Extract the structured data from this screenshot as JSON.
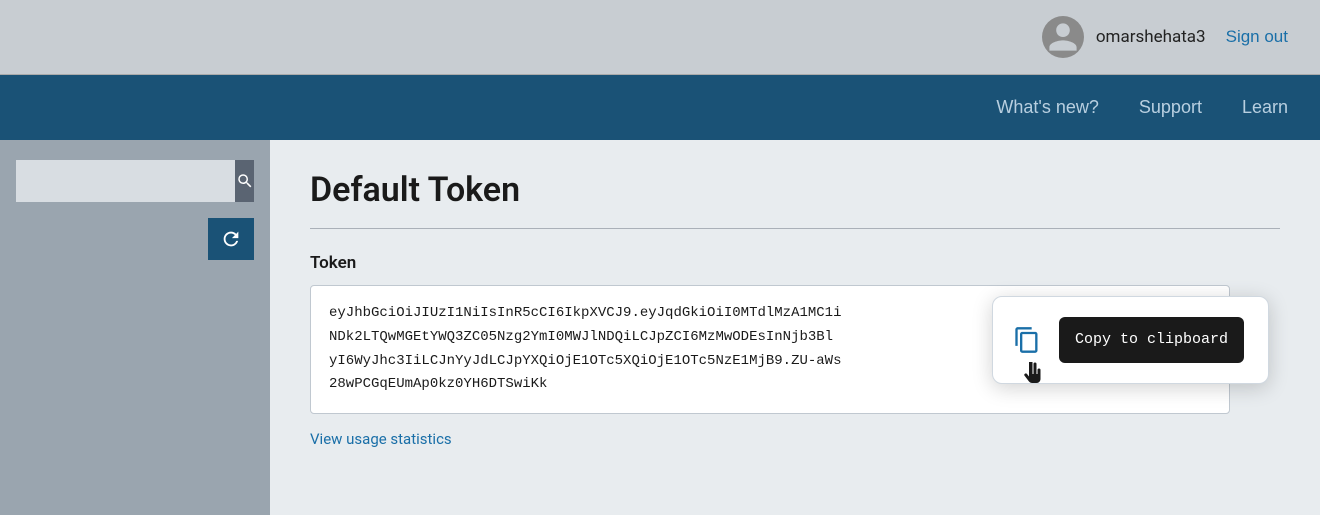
{
  "topbar": {
    "username": "omarshehata3",
    "sign_out_label": "Sign out"
  },
  "navbar": {
    "links": [
      {
        "id": "whats-new",
        "label": "What's new?"
      },
      {
        "id": "support",
        "label": "Support"
      },
      {
        "id": "learn",
        "label": "Learn"
      }
    ]
  },
  "sidebar": {
    "search_placeholder": "",
    "search_btn_label": "🔍",
    "refresh_label": "↻"
  },
  "content": {
    "page_title": "Default Token",
    "token_label": "Token",
    "token_value": "eyJhbGciOiJIUzI1NiIsInR5cCI6IkpXVCJ9.eyJqdGkiOiI0MTdlMzA1MC1i\nNDk2LTQwMGEtYWQ3ZC05Nzg2YmI0MWJlNDQiLCJpZCI6MzMwODEsInNjb3Bl\nyI6WyJhc3IiLCJnYyJdLCJpYXQiOjE1OTc5XQiOjE1OTc5NzE1MjB9.ZU-aWs\n28wPCGqEUmAp0kz0YH6DTSwiKk",
    "copy_tooltip": "Copy to clipboard",
    "view_usage_label": "View usage statistics"
  }
}
